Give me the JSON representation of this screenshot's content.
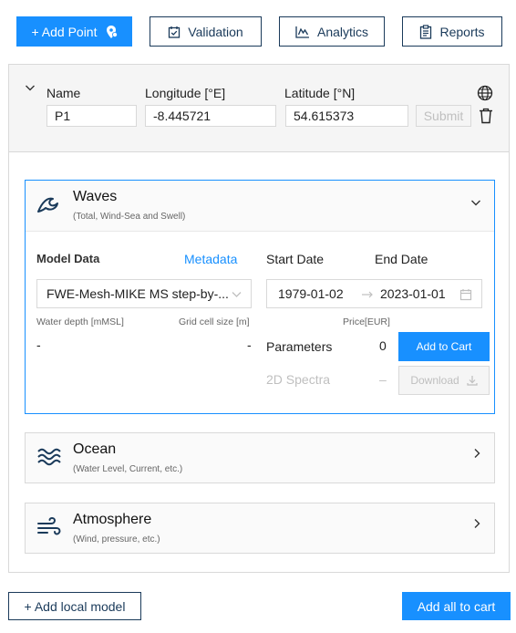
{
  "toolbar": {
    "add_point": "+ Add Point",
    "validation": "Validation",
    "analytics": "Analytics",
    "reports": "Reports"
  },
  "point": {
    "name_label": "Name",
    "longitude_label": "Longitude [°E]",
    "latitude_label": "Latitude [°N]",
    "name_value": "P1",
    "longitude_value": "-8.445721",
    "latitude_value": "54.615373",
    "submit_label": "Submit"
  },
  "waves": {
    "title": "Waves",
    "subtitle": "(Total, Wind-Sea and Swell)",
    "model_data_label": "Model Data",
    "metadata_link": "Metadata",
    "start_date_label": "Start Date",
    "end_date_label": "End Date",
    "model_value": "FWE-Mesh-MIKE MS step-by-...",
    "start_date": "1979-01-02",
    "end_date": "2023-01-01",
    "water_depth_label": "Water depth [mMSL]",
    "grid_cell_label": "Grid cell size [m]",
    "water_depth_value": "-",
    "grid_cell_value": "-",
    "price_label": "Price[EUR]",
    "parameters_label": "Parameters",
    "parameters_price": "0",
    "add_to_cart": "Add to Cart",
    "spectra_label": "2D Spectra",
    "spectra_price": "–",
    "download_label": "Download"
  },
  "ocean": {
    "title": "Ocean",
    "subtitle": "(Water Level, Current, etc.)"
  },
  "atmosphere": {
    "title": "Atmosphere",
    "subtitle": "(Wind, pressure, etc.)"
  },
  "footer": {
    "add_local_model": "+ Add local model",
    "add_all_to_cart": "Add all to cart"
  },
  "colors": {
    "primary": "#1890ff",
    "navy": "#1a3a5a",
    "border": "#d9d9d9"
  },
  "icons": {
    "add_point": "map-pin-icon",
    "validation": "calendar-check-icon",
    "analytics": "line-chart-icon",
    "reports": "clipboard-icon",
    "globe": "globe-icon",
    "delete": "trash-icon",
    "waves": "wave-icon",
    "ocean": "ocean-waves-icon",
    "atmosphere": "wind-icon"
  }
}
